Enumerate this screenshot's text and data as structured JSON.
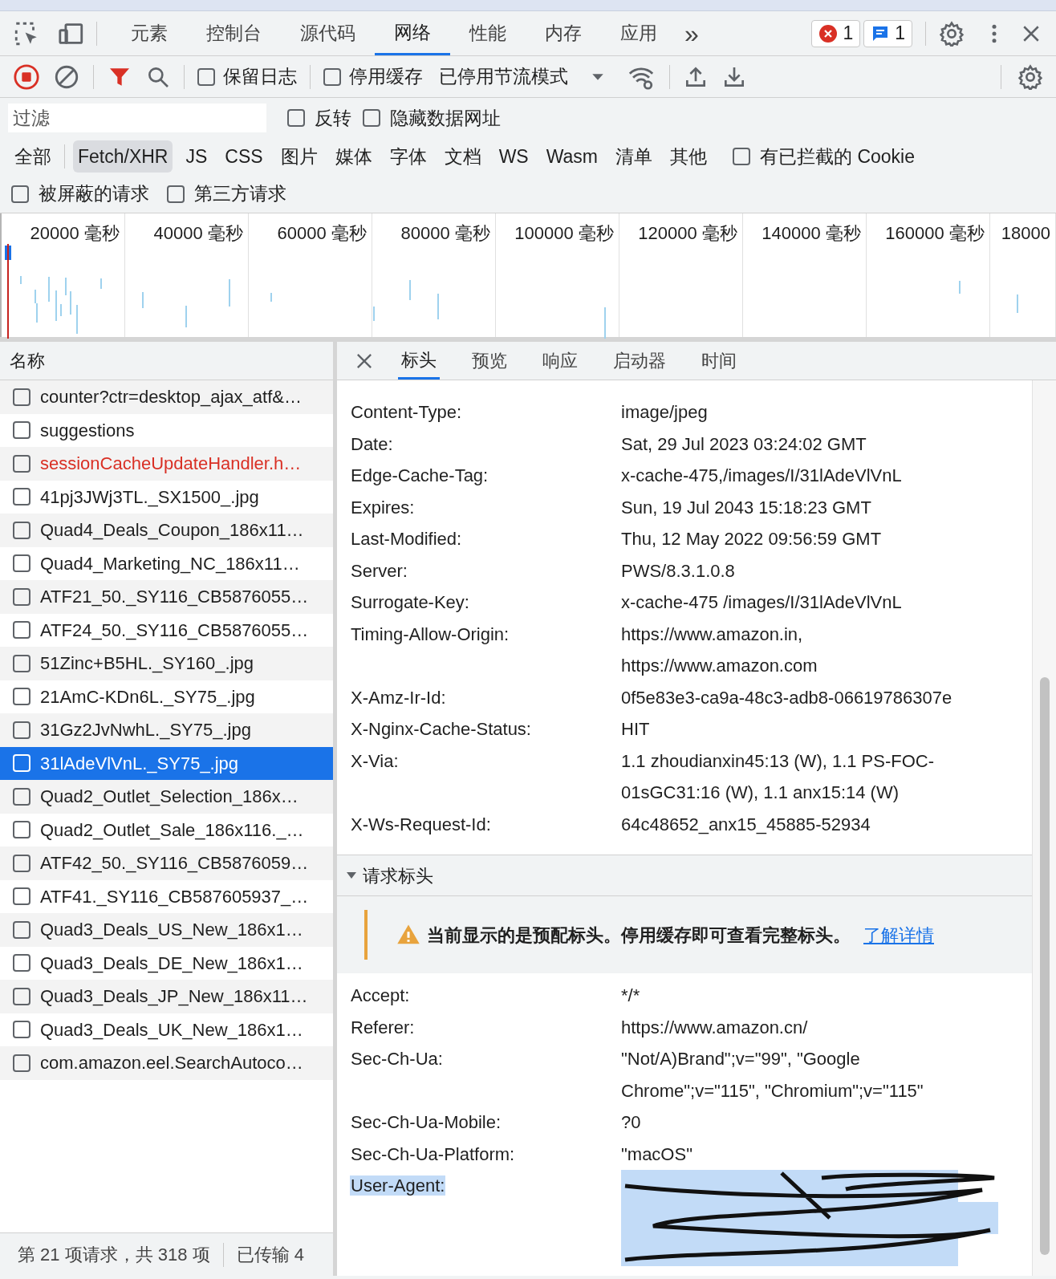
{
  "main_tabs": [
    {
      "label": "元素",
      "selected": false
    },
    {
      "label": "控制台",
      "selected": false
    },
    {
      "label": "源代码",
      "selected": false
    },
    {
      "label": "网络",
      "selected": true
    },
    {
      "label": "性能",
      "selected": false
    },
    {
      "label": "内存",
      "selected": false
    },
    {
      "label": "应用",
      "selected": false
    }
  ],
  "more_tabs": "»",
  "error_count": "1",
  "message_count": "1",
  "toolbar": {
    "recording": true,
    "preserve_log": {
      "label": "保留日志",
      "checked": false
    },
    "disable_cache": {
      "label": "停用缓存",
      "checked": false
    },
    "throttling": "已停用节流模式"
  },
  "filter": {
    "placeholder": "过滤",
    "invert": {
      "label": "反转",
      "checked": false
    },
    "hide_data_urls": {
      "label": "隐藏数据网址",
      "checked": false
    }
  },
  "type_filters": [
    {
      "label": "全部",
      "selected": false
    },
    {
      "label": "Fetch/XHR",
      "selected": true
    },
    {
      "label": "JS",
      "selected": false
    },
    {
      "label": "CSS",
      "selected": false
    },
    {
      "label": "图片",
      "selected": false
    },
    {
      "label": "媒体",
      "selected": false
    },
    {
      "label": "字体",
      "selected": false
    },
    {
      "label": "文档",
      "selected": false
    },
    {
      "label": "WS",
      "selected": false
    },
    {
      "label": "Wasm",
      "selected": false
    },
    {
      "label": "清单",
      "selected": false
    },
    {
      "label": "其他",
      "selected": false
    }
  ],
  "blocked_cookies": {
    "label": "有已拦截的 Cookie",
    "checked": false
  },
  "more_filters": [
    {
      "label": "被屏蔽的请求",
      "checked": false
    },
    {
      "label": "第三方请求",
      "checked": false
    }
  ],
  "timeline_ticks": [
    "20000 毫秒",
    "40000 毫秒",
    "60000 毫秒",
    "80000 毫秒",
    "100000 毫秒",
    "120000 毫秒",
    "140000 毫秒",
    "160000 毫秒",
    "18000"
  ],
  "requests": {
    "column": "名称",
    "rows": [
      {
        "name": "counter?ctr=desktop_ajax_atf&…",
        "selected": false,
        "failed": false,
        "checked": false
      },
      {
        "name": "suggestions",
        "selected": false,
        "failed": false,
        "checked": false
      },
      {
        "name": "sessionCacheUpdateHandler.h…",
        "selected": false,
        "failed": true,
        "checked": false
      },
      {
        "name": "41pj3JWj3TL._SX1500_.jpg",
        "selected": false,
        "failed": false,
        "checked": false
      },
      {
        "name": "Quad4_Deals_Coupon_186x11…",
        "selected": false,
        "failed": false,
        "checked": false
      },
      {
        "name": "Quad4_Marketing_NC_186x11…",
        "selected": false,
        "failed": false,
        "checked": false
      },
      {
        "name": "ATF21_50._SY116_CB5876055…",
        "selected": false,
        "failed": false,
        "checked": false
      },
      {
        "name": "ATF24_50._SY116_CB5876055…",
        "selected": false,
        "failed": false,
        "checked": false
      },
      {
        "name": "51Zinc+B5HL._SY160_.jpg",
        "selected": false,
        "failed": false,
        "checked": false
      },
      {
        "name": "21AmC-KDn6L._SY75_.jpg",
        "selected": false,
        "failed": false,
        "checked": false
      },
      {
        "name": "31Gz2JvNwhL._SY75_.jpg",
        "selected": false,
        "failed": false,
        "checked": false
      },
      {
        "name": "31lAdeVlVnL._SY75_.jpg",
        "selected": true,
        "failed": false,
        "checked": false
      },
      {
        "name": "Quad2_Outlet_Selection_186x…",
        "selected": false,
        "failed": false,
        "checked": false
      },
      {
        "name": "Quad2_Outlet_Sale_186x116._…",
        "selected": false,
        "failed": false,
        "checked": false
      },
      {
        "name": "ATF42_50._SY116_CB5876059…",
        "selected": false,
        "failed": false,
        "checked": false
      },
      {
        "name": "ATF41._SY116_CB587605937_…",
        "selected": false,
        "failed": false,
        "checked": false
      },
      {
        "name": "Quad3_Deals_US_New_186x1…",
        "selected": false,
        "failed": false,
        "checked": false
      },
      {
        "name": "Quad3_Deals_DE_New_186x1…",
        "selected": false,
        "failed": false,
        "checked": false
      },
      {
        "name": "Quad3_Deals_JP_New_186x11…",
        "selected": false,
        "failed": false,
        "checked": false
      },
      {
        "name": "Quad3_Deals_UK_New_186x1…",
        "selected": false,
        "failed": false,
        "checked": false
      },
      {
        "name": "com.amazon.eel.SearchAutoco…",
        "selected": false,
        "failed": false,
        "checked": false
      }
    ]
  },
  "status_bar": [
    "第 21 项请求，共 318 项",
    "已传输 4"
  ],
  "detail_tabs": [
    {
      "label": "标头",
      "selected": true
    },
    {
      "label": "预览",
      "selected": false
    },
    {
      "label": "响应",
      "selected": false
    },
    {
      "label": "启动器",
      "selected": false
    },
    {
      "label": "时间",
      "selected": false
    }
  ],
  "response_headers": [
    {
      "name": "Content-Type:",
      "value": "image/jpeg"
    },
    {
      "name": "Date:",
      "value": "Sat, 29 Jul 2023 03:24:02 GMT"
    },
    {
      "name": "Edge-Cache-Tag:",
      "value": "x-cache-475,/images/I/31lAdeVlVnL"
    },
    {
      "name": "Expires:",
      "value": "Sun, 19 Jul 2043 15:18:23 GMT"
    },
    {
      "name": "Last-Modified:",
      "value": "Thu, 12 May 2022 09:56:59 GMT"
    },
    {
      "name": "Server:",
      "value": "PWS/8.3.1.0.8"
    },
    {
      "name": "Surrogate-Key:",
      "value": "x-cache-475 /images/I/31lAdeVlVnL"
    },
    {
      "name": "Timing-Allow-Origin:",
      "value": "https://www.amazon.in, https://www.amazon.com"
    },
    {
      "name": "X-Amz-Ir-Id:",
      "value": "0f5e83e3-ca9a-48c3-adb8-06619786307e"
    },
    {
      "name": "X-Nginx-Cache-Status:",
      "value": "HIT"
    },
    {
      "name": "X-Via:",
      "value": "1.1 zhoudianxin45:13 (W), 1.1 PS-FOC-01sGC31:16 (W), 1.1 anx15:14 (W)"
    },
    {
      "name": "X-Ws-Request-Id:",
      "value": "64c48652_anx15_45885-52934"
    }
  ],
  "request_section": {
    "title": "请求标头",
    "expanded": true,
    "warning": "当前显示的是预配标头。停用缓存即可查看完整标头。",
    "link": "了解详情"
  },
  "request_headers": [
    {
      "name": "Accept:",
      "value": "*/*",
      "selected": false,
      "redacted": false
    },
    {
      "name": "Referer:",
      "value": "https://www.amazon.cn/",
      "selected": false,
      "redacted": false
    },
    {
      "name": "Sec-Ch-Ua:",
      "value": "\"Not/A)Brand\";v=\"99\", \"Google Chrome\";v=\"115\", \"Chromium\";v=\"115\"",
      "selected": false,
      "redacted": false
    },
    {
      "name": "Sec-Ch-Ua-Mobile:",
      "value": "?0",
      "selected": false,
      "redacted": false
    },
    {
      "name": "Sec-Ch-Ua-Platform:",
      "value": "\"macOS\"",
      "selected": false,
      "redacted": false
    },
    {
      "name": "User-Agent:",
      "selected": true,
      "redacted": true
    }
  ]
}
